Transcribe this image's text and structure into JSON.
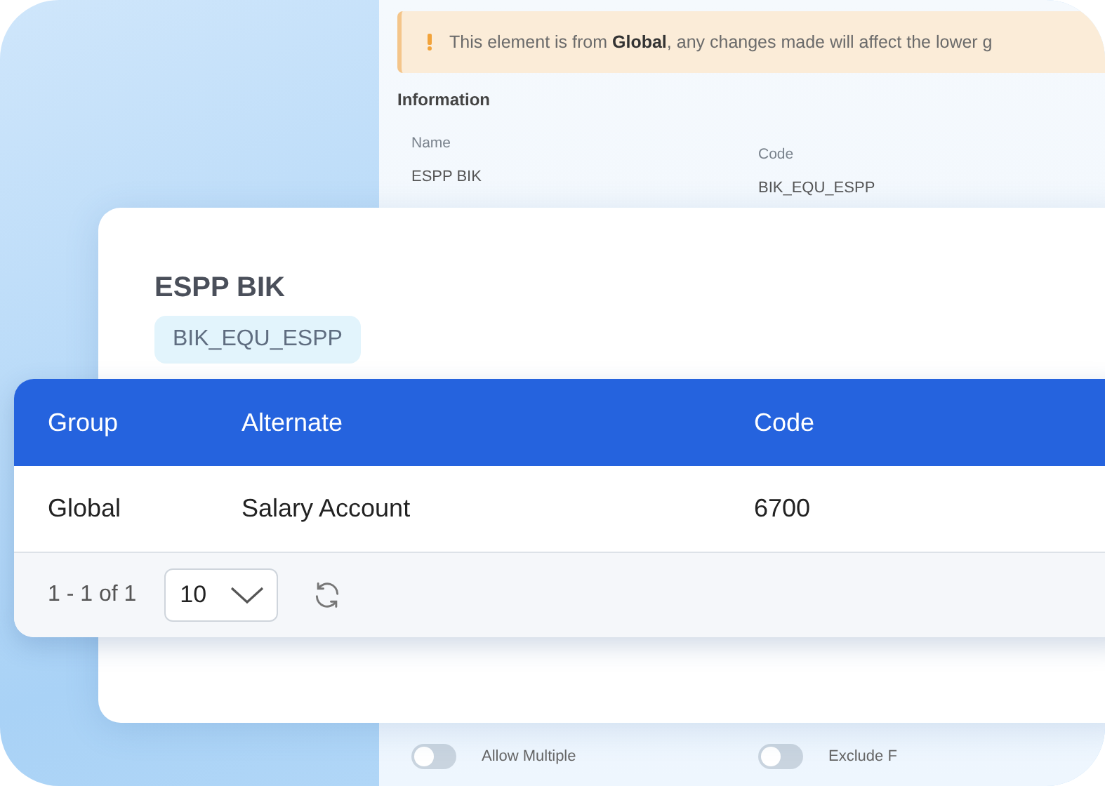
{
  "background_form": {
    "warning": "This element is from **Global**, any changes made will affect the lower g",
    "section_title": "Information",
    "fields": [
      {
        "label": "Name",
        "value": "ESPP BIK"
      },
      {
        "label": "Code",
        "value": "BIK_EQU_ESPP"
      }
    ],
    "toggles": [
      {
        "label": "Allow Multiple",
        "on": false
      },
      {
        "label": "Exclude F",
        "on": false
      }
    ]
  },
  "detail_card": {
    "title": "ESPP BIK",
    "code": "BIK_EQU_ESPP"
  },
  "table": {
    "columns": [
      "Group",
      "Alternate",
      "Code"
    ],
    "rows": [
      [
        "Global",
        "Salary Account",
        "6700"
      ]
    ],
    "pagination": {
      "range": "1 - 1 of 1",
      "page_size": "10"
    }
  }
}
